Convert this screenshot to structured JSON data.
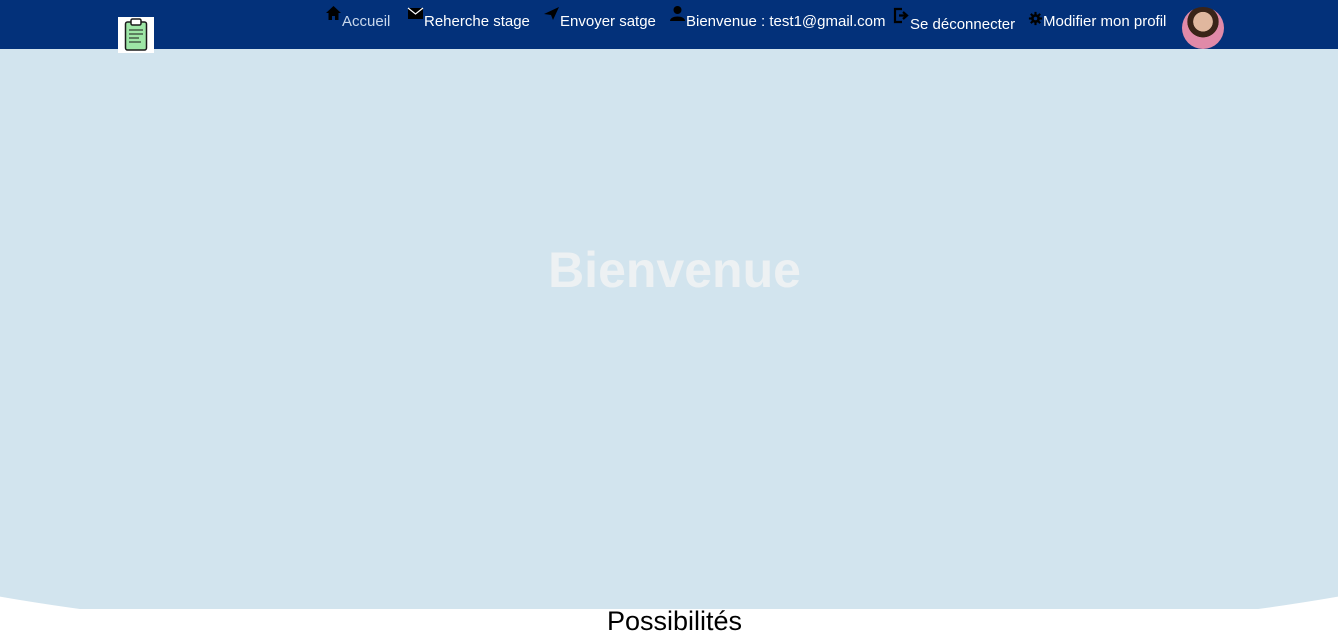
{
  "navbar": {
    "logo_icon": "clipboard-icon",
    "items": [
      {
        "label": "Accueil",
        "icon": "home-icon",
        "active": true
      },
      {
        "label": "Reherche stage",
        "icon": "envelope-icon"
      },
      {
        "label": "Envoyer satge",
        "icon": "send-icon"
      },
      {
        "label": "Bienvenue : test1@gmail.com",
        "icon": "user-icon"
      },
      {
        "label": "Se déconnecter",
        "icon": "logout-icon"
      },
      {
        "label": "Modifier mon profil",
        "icon": "gear-icon"
      }
    ],
    "avatar": "profile-photo"
  },
  "hero": {
    "title": "Bienvenue"
  },
  "section": {
    "title": "Possibilités"
  },
  "colors": {
    "navbar": "#03317a",
    "hero": "#d2e4ee",
    "hero_title": "#edf1f3"
  }
}
